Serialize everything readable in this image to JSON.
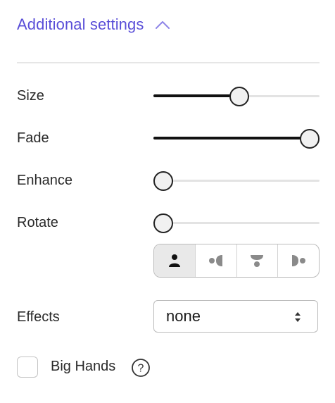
{
  "section": {
    "title": "Additional settings",
    "icon": "chevron-up-icon",
    "accent_color": "#5a4fd8"
  },
  "sliders": [
    {
      "label": "Size",
      "value": 0.52
    },
    {
      "label": "Fade",
      "value": 1.0
    },
    {
      "label": "Enhance",
      "value": 0.0
    },
    {
      "label": "Rotate",
      "value": 0.0
    }
  ],
  "view_options": {
    "selected_index": 0,
    "icons": [
      "front-view-icon",
      "side-left-view-icon",
      "top-view-icon",
      "side-right-view-icon"
    ]
  },
  "effects": {
    "label": "Effects",
    "value": "none"
  },
  "big_hands": {
    "label": "Big Hands",
    "checked": false,
    "help_icon": "question-circle-icon"
  }
}
